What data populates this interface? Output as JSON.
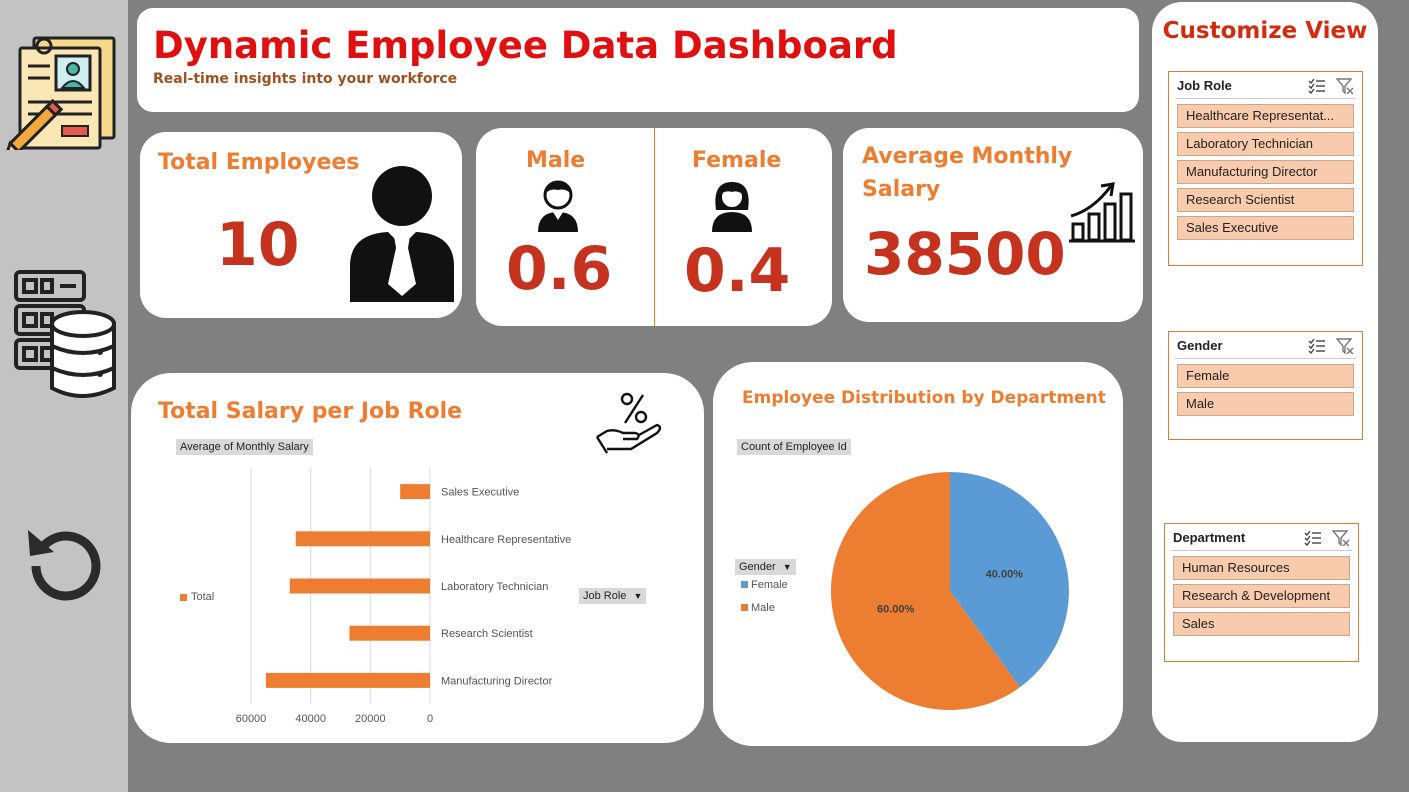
{
  "header": {
    "title": "Dynamic Employee Data Dashboard",
    "subtitle": "Real-time insights into your workforce"
  },
  "sidebar": {
    "icons": [
      "employee-profile-icon",
      "database-icon",
      "reset-icon"
    ]
  },
  "kpis": {
    "total_employees": {
      "label": "Total Employees",
      "value": "10"
    },
    "male": {
      "label": "Male",
      "value": "0.6"
    },
    "female": {
      "label": "Female",
      "value": "0.4"
    },
    "avg_salary": {
      "label_line1": "Average Monthly",
      "label_line2": "Salary",
      "value": "38500"
    }
  },
  "bar_chart_card": {
    "title": "Total Salary per Job Role",
    "field_button": "Average of Monthly Salary",
    "axis_button": "Job Role",
    "legend_label": "Total"
  },
  "pie_chart_card": {
    "title": "Employee Distribution  by Department",
    "field_button": "Count of Employee Id",
    "legend_button": "Gender"
  },
  "chart_data": [
    {
      "type": "bar",
      "orientation": "horizontal",
      "categories": [
        "Sales Executive",
        "Healthcare Representative",
        "Laboratory Technician",
        "Research Scientist",
        "Manufacturing Director"
      ],
      "series": [
        {
          "name": "Total",
          "values": [
            10000,
            45000,
            47000,
            27000,
            55000
          ]
        }
      ],
      "xlim": [
        0,
        60000
      ],
      "x_reversed": true,
      "ticks": [
        "60000",
        "40000",
        "20000",
        "0"
      ],
      "grid": true,
      "legend": "left",
      "colors": [
        "#ed7d31"
      ]
    },
    {
      "type": "pie",
      "categories": [
        "Female",
        "Male"
      ],
      "values": [
        40,
        60
      ],
      "labels": [
        "40.00%",
        "60.00%"
      ],
      "legend": "left",
      "colors": [
        "#5b9bd5",
        "#ed7d31"
      ]
    }
  ],
  "customize": {
    "title": "Customize View",
    "slicers": [
      {
        "label": "Job Role",
        "items": [
          "Healthcare Representat...",
          "Laboratory Technician",
          "Manufacturing Director",
          "Research Scientist",
          "Sales Executive"
        ]
      },
      {
        "label": "Gender",
        "items": [
          "Female",
          "Male"
        ]
      },
      {
        "label": "Department",
        "items": [
          "Human Resources",
          "Research & Development",
          "Sales"
        ]
      }
    ]
  },
  "colors": {
    "accent": "#ed7d31",
    "title_red": "#e01010",
    "value_red": "#c5321e",
    "slicer_fill": "#f8cbad",
    "pie_female": "#5b9bd5",
    "pie_male": "#ed7d31"
  }
}
